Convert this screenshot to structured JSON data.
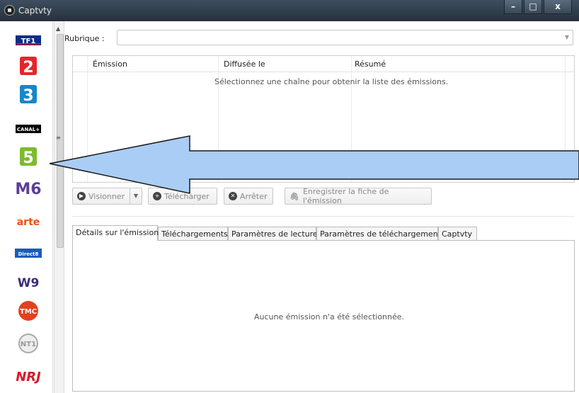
{
  "window": {
    "title": "Captvty"
  },
  "channels": [
    "TF1",
    "2",
    "3",
    "CANAL+",
    "5",
    "M6",
    "arte",
    "Direct8",
    "W9",
    "TMC",
    "NT1",
    "NRJ"
  ],
  "rubrique": {
    "label": "Rubrique :",
    "value": ""
  },
  "table": {
    "headers": [
      "Émission",
      "Diffusée le",
      "Résumé"
    ],
    "empty_message": "Sélectionnez une chaîne pour obtenir la liste des émissions."
  },
  "toolbar": {
    "visionner": "Visionner",
    "telecharger": "Télécharger",
    "arreter": "Arrêter",
    "enregistrer": "Enregistrer la fiche de l'émission"
  },
  "tabs": [
    "Détails sur l'émission",
    "Téléchargements",
    "Paramètres de lecture",
    "Paramètres de téléchargement",
    "Captvty"
  ],
  "details": {
    "empty_message": "Aucune émission n'a été sélectionnée."
  },
  "colors": {
    "arrow_fill": "#a9cdf5",
    "arrow_stroke": "#1a1a1a"
  }
}
